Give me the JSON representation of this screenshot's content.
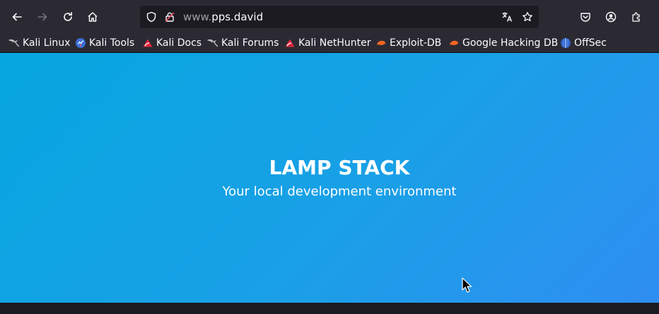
{
  "browser": {
    "url_prefix": "www.",
    "url_domain": "pps.david"
  },
  "bookmarks": [
    {
      "label": "Kali Linux",
      "icon": "kali-dragon-icon"
    },
    {
      "label": "Kali Tools",
      "icon": "kali-tools-icon"
    },
    {
      "label": "Kali Docs",
      "icon": "kali-docs-icon"
    },
    {
      "label": "Kali Forums",
      "icon": "kali-dragon-icon"
    },
    {
      "label": "Kali NetHunter",
      "icon": "kali-nethunter-icon"
    },
    {
      "label": "Exploit-DB",
      "icon": "exploit-db-icon"
    },
    {
      "label": "Google Hacking DB",
      "icon": "exploit-db-icon"
    },
    {
      "label": "OffSec",
      "icon": "offsec-icon"
    }
  ],
  "page": {
    "title": "LAMP STACK",
    "subtitle": "Your local development environment"
  },
  "colors": {
    "toolbar": "#2b2a33",
    "urlbar": "#1c1b22",
    "gradient_start": "#06a6e0",
    "gradient_end": "#2f8ef2"
  }
}
